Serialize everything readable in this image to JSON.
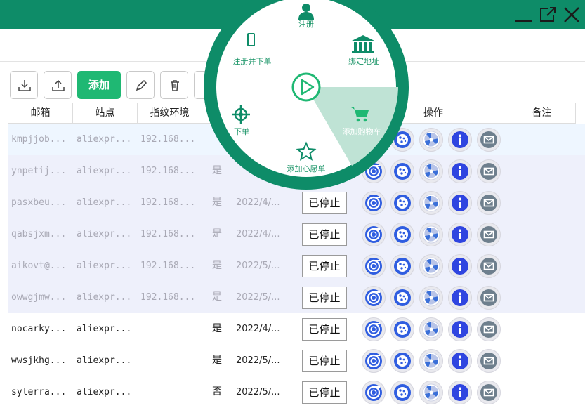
{
  "window": {
    "minimize_icon": "minimize-icon",
    "popout_icon": "popout-icon",
    "close_icon": "close-icon"
  },
  "toolbar": {
    "import_icon": "download-icon",
    "export_icon": "upload-icon",
    "add_label": "添加",
    "edit_icon": "pencil-icon",
    "delete_icon": "trash-icon"
  },
  "table": {
    "columns": [
      "邮箱",
      "站点",
      "指纹环境",
      "操作",
      "备注"
    ],
    "rows": [
      {
        "email": "kmpjjob...",
        "site": "aliexpr...",
        "fingerprint": "192.168...",
        "flag": "",
        "date": "",
        "status": "",
        "style": "grey",
        "selected": true
      },
      {
        "email": "ynpetij...",
        "site": "aliexpr...",
        "fingerprint": "192.168...",
        "flag": "是",
        "date": "",
        "status": "",
        "style": "grey"
      },
      {
        "email": "pasxbeu...",
        "site": "aliexpr...",
        "fingerprint": "192.168...",
        "flag": "是",
        "date": "2022/4/...",
        "status": "已停止",
        "style": "grey"
      },
      {
        "email": "qabsjxm...",
        "site": "aliexpr...",
        "fingerprint": "192.168...",
        "flag": "是",
        "date": "2022/4/...",
        "status": "已停止",
        "style": "grey"
      },
      {
        "email": "aikovt@...",
        "site": "aliexpr...",
        "fingerprint": "192.168...",
        "flag": "是",
        "date": "2022/5/...",
        "status": "已停止",
        "style": "grey"
      },
      {
        "email": "owwgjmw...",
        "site": "aliexpr...",
        "fingerprint": "192.168...",
        "flag": "是",
        "date": "2022/5/...",
        "status": "已停止",
        "style": "grey"
      },
      {
        "email": "nocarky...",
        "site": "aliexpr...",
        "fingerprint": "",
        "flag": "是",
        "date": "2022/4/...",
        "status": "已停止",
        "style": "dark"
      },
      {
        "email": "wwsjkhg...",
        "site": "aliexpr...",
        "fingerprint": "",
        "flag": "是",
        "date": "2022/5/...",
        "status": "已停止",
        "style": "dark"
      },
      {
        "email": "sylerra...",
        "site": "aliexpr...",
        "fingerprint": "",
        "flag": "否",
        "date": "2022/5/...",
        "status": "已停止",
        "style": "dark"
      }
    ],
    "action_icons": [
      "chrome-icon",
      "cookie-icon",
      "fan-icon",
      "info-icon",
      "mail-icon"
    ]
  },
  "radial_menu": {
    "items": [
      {
        "label": "注册",
        "icon": "user-icon"
      },
      {
        "label": "绑定地址",
        "icon": "bank-icon"
      },
      {
        "label": "添加购物车",
        "icon": "cart-icon",
        "active": true
      },
      {
        "label": "添加心愿单",
        "icon": "star-icon"
      },
      {
        "label": "下单",
        "icon": "crosshair-icon"
      },
      {
        "label": "注册并下单",
        "icon": "phone-icon"
      }
    ],
    "center_icon": "play-icon",
    "colors": {
      "ring": "#0e8c68",
      "accent": "#1fb873",
      "active_slice": "#bfe3d5"
    }
  },
  "colors": {
    "titlebar": "#0e8c68",
    "add_button": "#1fb873",
    "selected_row": "#eef6ff",
    "grey_row": "#eef0fb"
  }
}
